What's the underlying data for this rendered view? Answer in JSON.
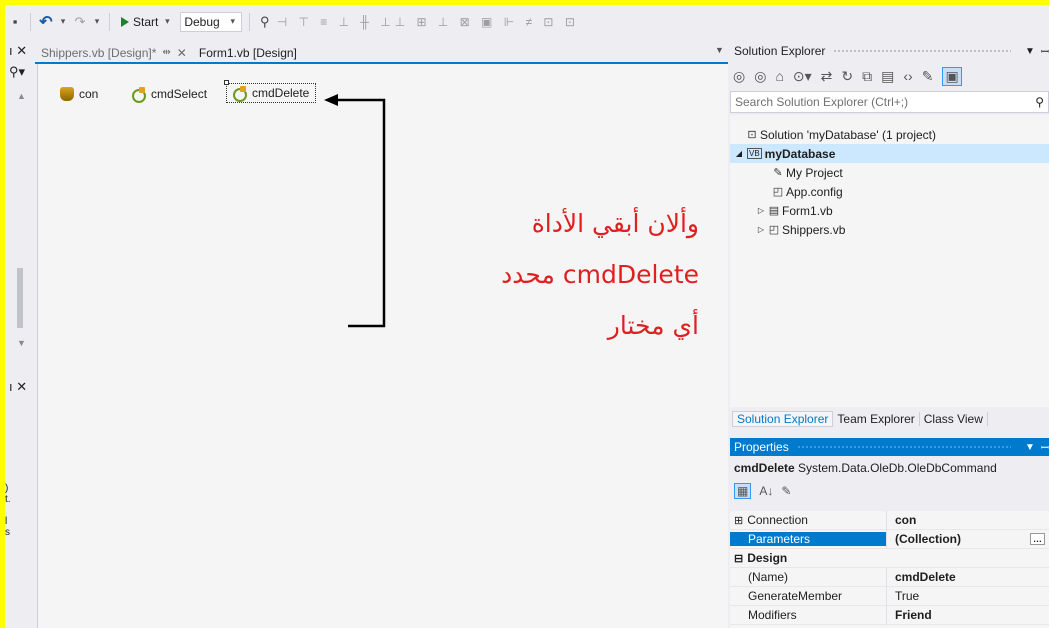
{
  "toolbar": {
    "start_label": "Start",
    "config_value": "Debug"
  },
  "tabs": [
    {
      "label": "Shippers.vb [Design]*"
    },
    {
      "label": "Form1.vb [Design]"
    }
  ],
  "components": [
    {
      "label": "con"
    },
    {
      "label": "cmdSelect"
    },
    {
      "label": "cmdDelete"
    }
  ],
  "annotation": {
    "line1": "وألان أبقي الأداة",
    "line2": "cmdDelete محدد",
    "line3": "أي مختار"
  },
  "solution_explorer": {
    "title": "Solution Explorer",
    "search_placeholder": "Search Solution Explorer (Ctrl+;)",
    "tree": [
      {
        "label": "Solution 'myDatabase' (1 project)"
      },
      {
        "label": "myDatabase"
      },
      {
        "label": "My Project"
      },
      {
        "label": "App.config"
      },
      {
        "label": "Form1.vb"
      },
      {
        "label": "Shippers.vb"
      }
    ],
    "bottom_tabs": [
      {
        "label": "Solution Explorer"
      },
      {
        "label": "Team Explorer"
      },
      {
        "label": "Class View"
      }
    ]
  },
  "properties": {
    "title": "Properties",
    "object_name": "cmdDelete",
    "object_type": "System.Data.OleDb.OleDbCommand",
    "rows": [
      {
        "name": "Connection",
        "value": "con"
      },
      {
        "name": "Parameters",
        "value": "(Collection)"
      },
      {
        "name": "Design",
        "value": ""
      },
      {
        "name": "(Name)",
        "value": "cmdDelete"
      },
      {
        "name": "GenerateMember",
        "value": "True"
      },
      {
        "name": "Modifiers",
        "value": "Friend"
      }
    ]
  },
  "colors": {
    "frame": "#ffff00",
    "accent": "#007acc",
    "annotation": "#e02020"
  }
}
